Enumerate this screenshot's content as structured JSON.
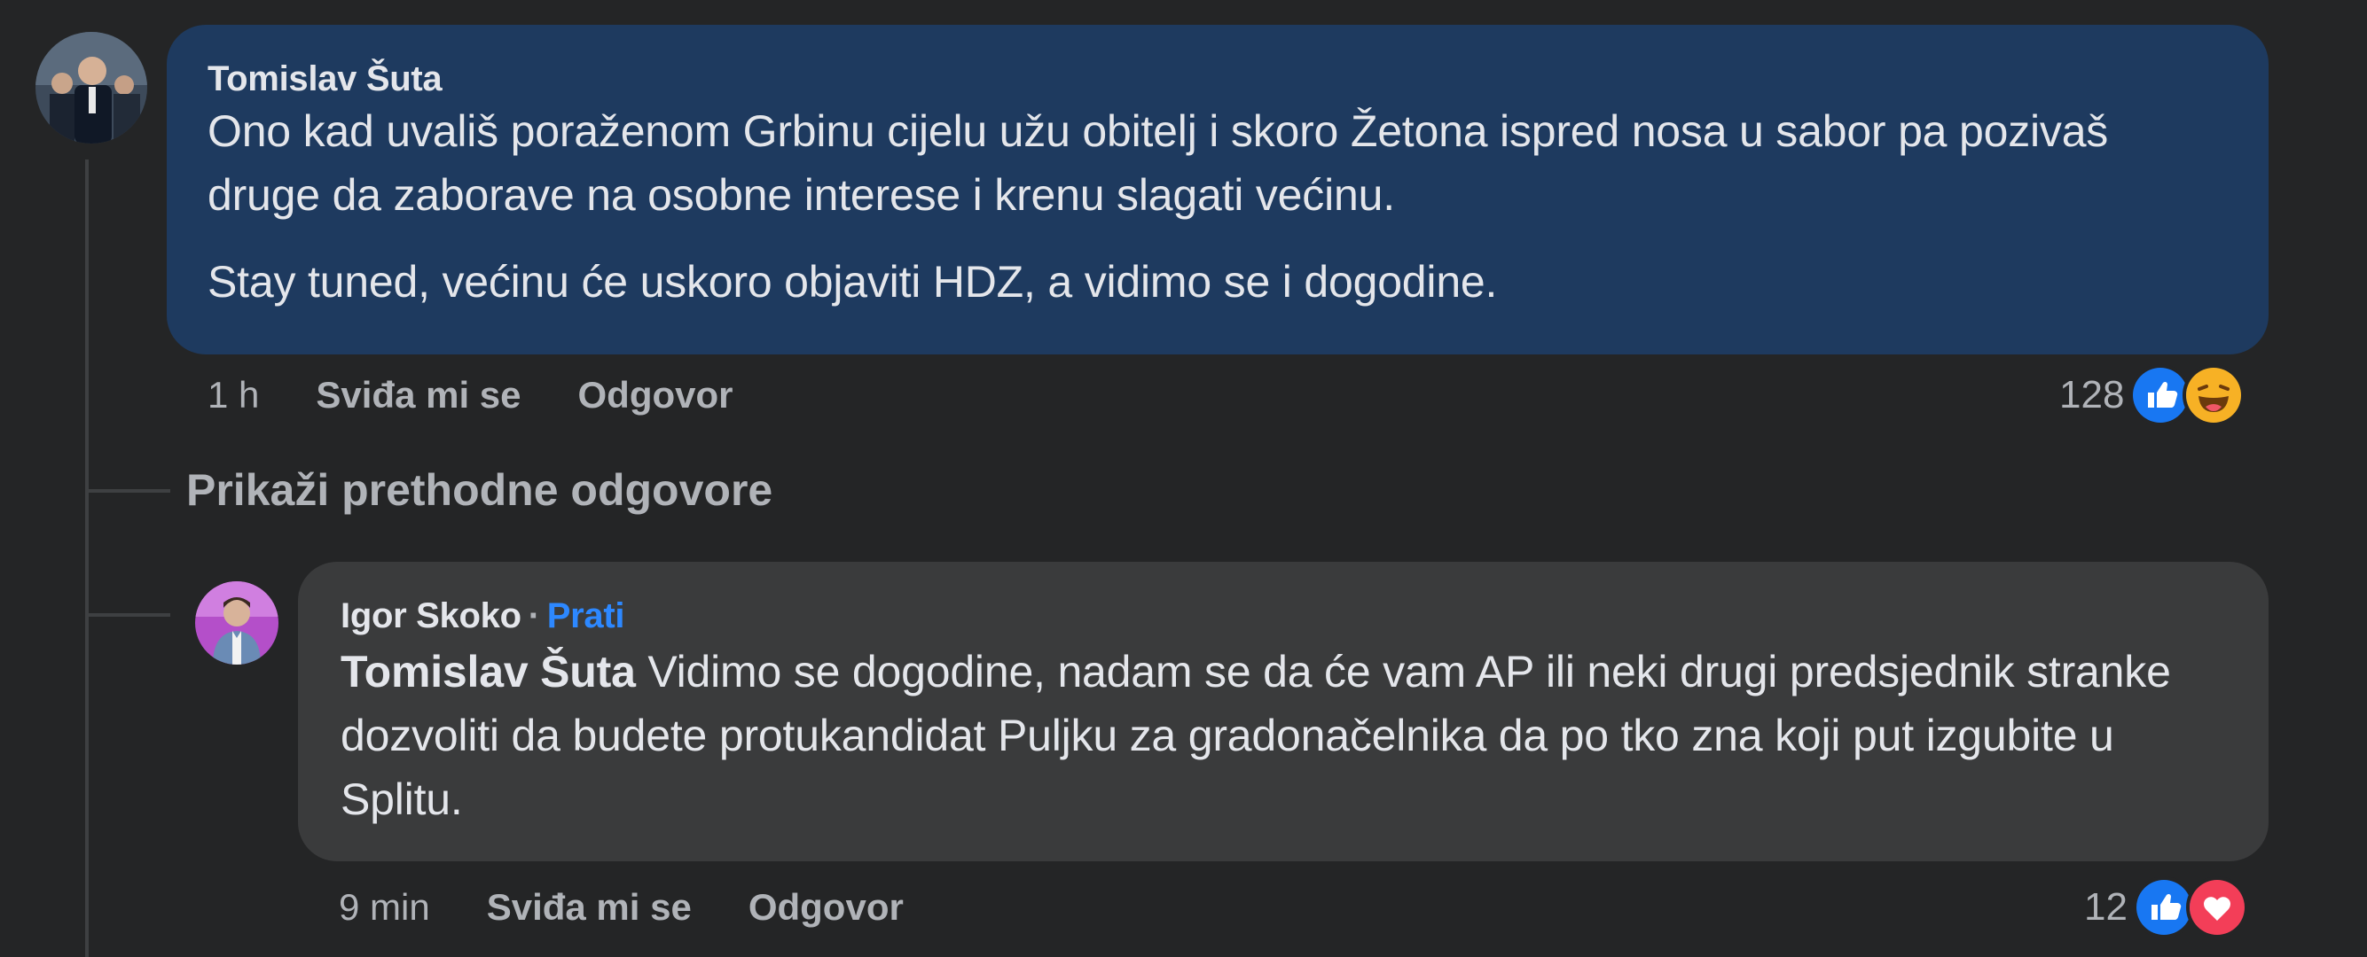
{
  "colors": {
    "background": "#242526",
    "main_bubble": "#1e3a5f",
    "reply_bubble": "#3a3b3c",
    "text": "#e4e6eb",
    "muted": "#b0b3b8",
    "link": "#2d88ff",
    "like": "#1877f2",
    "love": "#f33e58",
    "haha": "#f7b125"
  },
  "comment": {
    "author": "Tomislav Šuta",
    "paragraph1": "Ono kad uvališ poraženom Grbinu cijelu užu obitelj i skoro Žetona ispred nosa u sabor pa pozivaš druge da zaborave na osobne interese i krenu slagati većinu.",
    "paragraph2": "Stay tuned, većinu će uskoro objaviti HDZ, a vidimo se i dogodine.",
    "time": "1 h",
    "like_label": "Sviđa mi se",
    "reply_label": "Odgovor",
    "reaction_count": "128",
    "reaction_icons": [
      "like-icon",
      "haha-icon"
    ]
  },
  "show_previous": "Prikaži prethodne odgovore",
  "reply": {
    "author": "Igor Skoko",
    "separator": "·",
    "follow_label": "Prati",
    "mention": "Tomislav Šuta",
    "text": " Vidimo se dogodine, nadam se da će vam AP ili neki drugi predsjednik stranke dozvoliti da budete protukandidat Puljku za gradonačelnika da po tko zna koji put izgubite u Splitu.",
    "time": "9 min",
    "like_label": "Sviđa mi se",
    "reply_label": "Odgovor",
    "reaction_count": "12",
    "reaction_icons": [
      "like-icon",
      "love-icon"
    ]
  }
}
